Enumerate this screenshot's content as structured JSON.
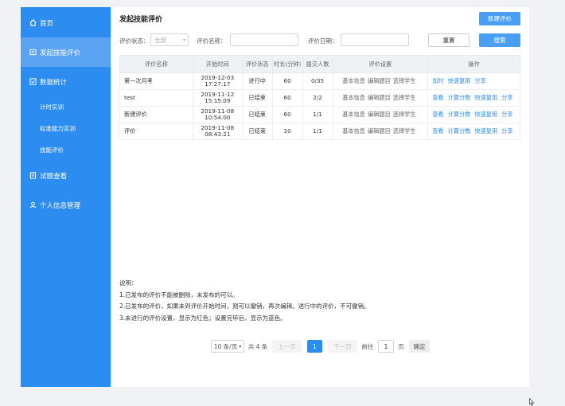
{
  "sidebar": {
    "items": [
      {
        "label": "首页",
        "icon": "home-icon"
      },
      {
        "label": "发起技能评价",
        "icon": "form-icon"
      },
      {
        "label": "数据统计",
        "icon": "checkbox-icon"
      },
      {
        "label": "计时实训"
      },
      {
        "label": "标准能力实训"
      },
      {
        "label": "技能评价"
      },
      {
        "label": "试题查看",
        "icon": "document-icon"
      },
      {
        "label": "个人信息管理",
        "icon": "user-icon"
      }
    ]
  },
  "header": {
    "title": "发起技能评价",
    "new_button": "新建评价"
  },
  "filters": {
    "status_label": "评价状态：",
    "status_value": "全部",
    "name_label": "评价名称：",
    "date_label": "评价日期：",
    "reset_button": "重置",
    "search_button": "搜索"
  },
  "table": {
    "headers": [
      "评价名称",
      "开始时间",
      "评价状态",
      "时长(分钟)",
      "提交人数",
      "评价设置",
      "操作"
    ],
    "rows": [
      {
        "name": "第一次月考",
        "start_date": "2019-12-03",
        "start_time": "17:27:17",
        "status": "进行中",
        "duration": "60",
        "submitted": "0/35",
        "settings": [
          "基本信息",
          "编辑题目",
          "选择学生"
        ],
        "actions": [
          "加时",
          "快速复用",
          "分享"
        ]
      },
      {
        "name": "test",
        "start_date": "2019-11-12",
        "start_time": "15:15:09",
        "status": "已结束",
        "duration": "60",
        "submitted": "2/2",
        "settings": [
          "基本信息",
          "编辑题目",
          "选择学生"
        ],
        "actions": [
          "查看",
          "计算分数",
          "快速复用",
          "分享"
        ]
      },
      {
        "name": "新建评价",
        "start_date": "2019-11-08",
        "start_time": "10:54:00",
        "status": "已结束",
        "duration": "60",
        "submitted": "1/1",
        "settings": [
          "基本信息",
          "编辑题目",
          "选择学生"
        ],
        "actions": [
          "查看",
          "计算分数",
          "快速复用",
          "分享"
        ]
      },
      {
        "name": "评价",
        "start_date": "2019-11-08",
        "start_time": "08:43:21",
        "status": "已结束",
        "duration": "10",
        "submitted": "1/1",
        "settings": [
          "基本信息",
          "编辑题目",
          "选择学生"
        ],
        "actions": [
          "查看",
          "计算分数",
          "快速复用",
          "分享"
        ]
      }
    ]
  },
  "notes": {
    "title": "说明：",
    "lines": [
      "1.已发布的评价不能被删除，未发布的可以。",
      "2.已发布的评价，如果未到评价开始时间，则可以撤销，再次编辑。进行中的评价，不可撤销。",
      "3.未进行的评价设置，显示为红色；设置完毕后，显示为蓝色。"
    ]
  },
  "pagination": {
    "page_size": "10 条/页",
    "total": "共 4 条",
    "prev": "上一页",
    "current": "1",
    "next": "下一页",
    "goto_label": "前往",
    "goto_value": "1",
    "page_unit": "页",
    "confirm": "确定"
  },
  "colors": {
    "sidebar": "#2d8cf0",
    "active": "#5aa3f3",
    "link": "#2d8cf0",
    "danger": "#ee3333"
  }
}
